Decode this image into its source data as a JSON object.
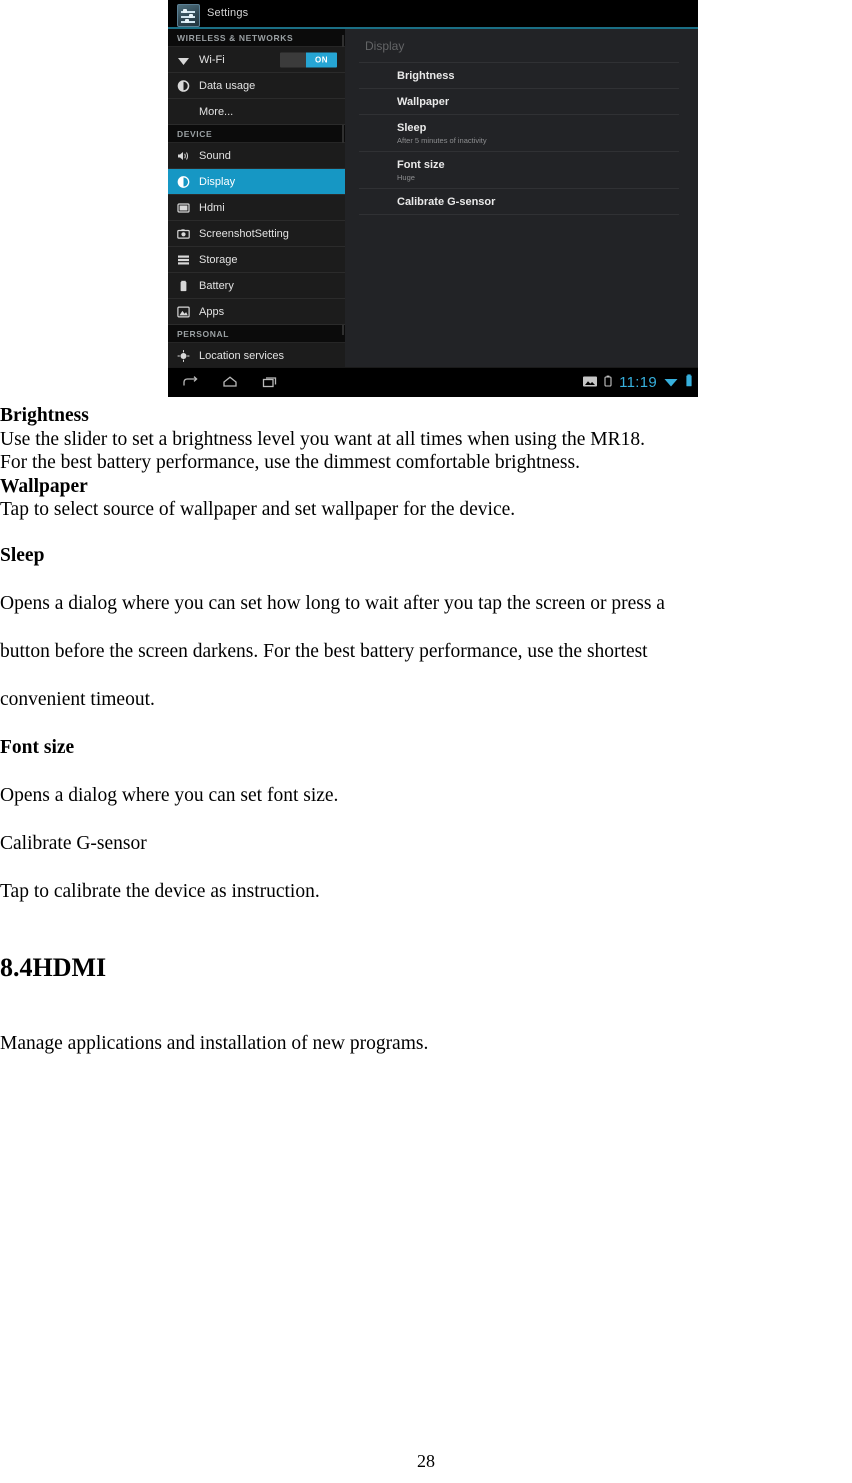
{
  "screenshot": {
    "app_title": "Settings",
    "app_icon": "settings-sliders-icon",
    "sidebar": {
      "sections": [
        {
          "label": "WIRELESS & NETWORKS",
          "items": [
            {
              "label": "Wi-Fi",
              "icon": "wifi-icon",
              "toggle": "ON",
              "selected": false
            },
            {
              "label": "Data usage",
              "icon": "data-usage-icon",
              "selected": false
            },
            {
              "label": "More...",
              "icon": "",
              "selected": false
            }
          ]
        },
        {
          "label": "DEVICE",
          "items": [
            {
              "label": "Sound",
              "icon": "speaker-icon",
              "selected": false
            },
            {
              "label": "Display",
              "icon": "brightness-icon",
              "selected": true
            },
            {
              "label": "Hdmi",
              "icon": "monitor-icon",
              "selected": false
            },
            {
              "label": "ScreenshotSetting",
              "icon": "camera-icon",
              "selected": false
            },
            {
              "label": "Storage",
              "icon": "storage-icon",
              "selected": false
            },
            {
              "label": "Battery",
              "icon": "battery-icon",
              "selected": false
            },
            {
              "label": "Apps",
              "icon": "apps-icon",
              "selected": false
            }
          ]
        },
        {
          "label": "PERSONAL",
          "items": [
            {
              "label": "Location services",
              "icon": "location-icon",
              "selected": false
            }
          ]
        }
      ]
    },
    "detail": {
      "header": "Display",
      "rows": [
        {
          "title": "Brightness",
          "sub": ""
        },
        {
          "title": "Wallpaper",
          "sub": ""
        },
        {
          "title": "Sleep",
          "sub": "After 5 minutes of inactivity"
        },
        {
          "title": "Font size",
          "sub": "Huge"
        },
        {
          "title": "Calibrate G-sensor",
          "sub": ""
        }
      ]
    },
    "navbar": {
      "back": "back-icon",
      "home": "home-icon",
      "recents": "recents-icon",
      "status": {
        "screenshot_indicator": "image-icon",
        "usb_indicator": "usb-icon",
        "clock": "11:19",
        "wifi": "wifi-signal-icon",
        "battery": "battery-icon"
      }
    },
    "colors": {
      "accent": "#1697c4",
      "clock": "#37b0dd",
      "toggle_on": "#26a5d4",
      "panel_bg": "#222326",
      "sidebar_bg": "#1c1c1c"
    }
  },
  "document": {
    "blocks": [
      {
        "style": "tight-bold",
        "text": "Brightness"
      },
      {
        "style": "tight",
        "text": "Use the slider to set a brightness level you want at all times when using the MR18."
      },
      {
        "style": "tight",
        "text": "For the best battery performance, use the dimmest comfortable brightness."
      },
      {
        "style": "tight-bold",
        "text": "Wallpaper"
      },
      {
        "style": "tight",
        "text": "Tap to select source of wallpaper and set wallpaper for the device."
      },
      {
        "style": "loose-bold",
        "text": "Sleep"
      },
      {
        "style": "loose",
        "text": "Opens a dialog where you can set how long to wait after you tap the screen or press a"
      },
      {
        "style": "loose",
        "text": "button before the screen darkens. For the best battery performance, use the shortest"
      },
      {
        "style": "loose",
        "text": "convenient timeout."
      },
      {
        "style": "loose-bold",
        "text": "Font size"
      },
      {
        "style": "loose",
        "text": "Opens a dialog where you can set font size."
      },
      {
        "style": "loose",
        "text": "Calibrate G-sensor"
      },
      {
        "style": "loose",
        "text": "Tap to calibrate the device as instruction."
      },
      {
        "style": "heading",
        "text": "8.4HDMI"
      },
      {
        "style": "loose",
        "text": "Manage applications and installation of new programs."
      }
    ]
  },
  "footer": {
    "page_number": "28"
  }
}
